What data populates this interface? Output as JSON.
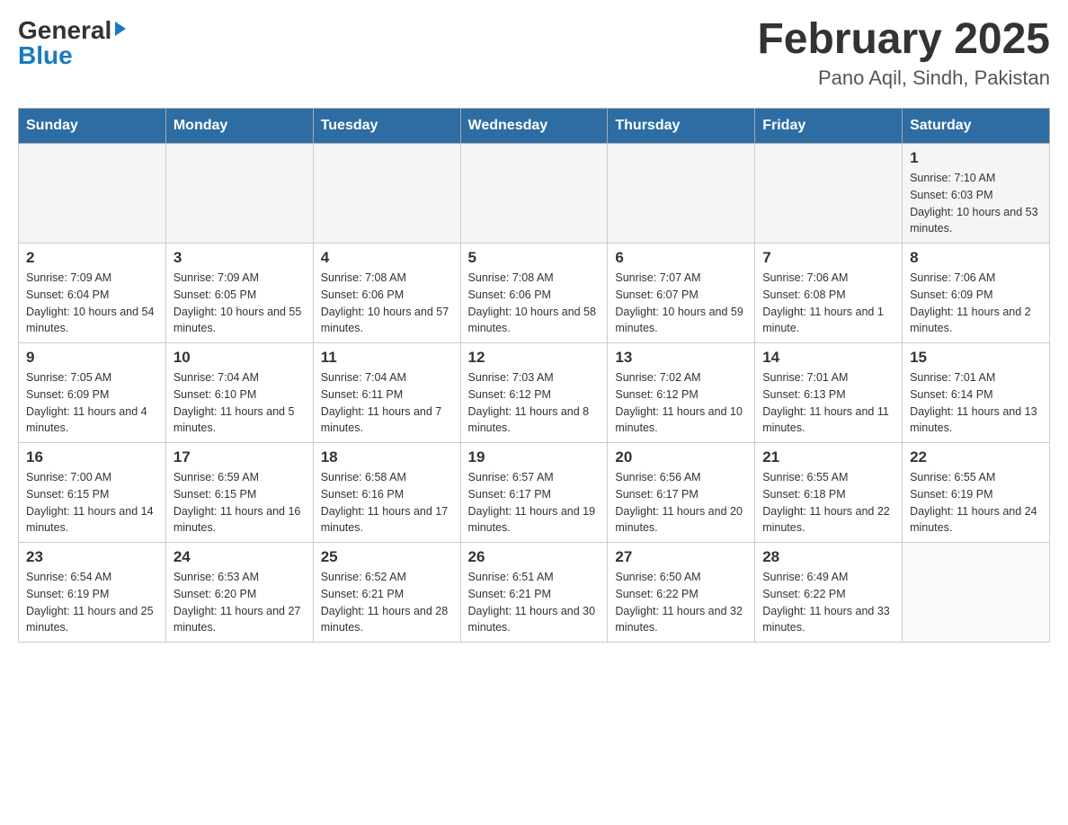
{
  "header": {
    "logo_general": "General",
    "logo_blue": "Blue",
    "month_title": "February 2025",
    "location": "Pano Aqil, Sindh, Pakistan"
  },
  "days_of_week": [
    "Sunday",
    "Monday",
    "Tuesday",
    "Wednesday",
    "Thursday",
    "Friday",
    "Saturday"
  ],
  "weeks": [
    [
      {
        "day": "",
        "info": ""
      },
      {
        "day": "",
        "info": ""
      },
      {
        "day": "",
        "info": ""
      },
      {
        "day": "",
        "info": ""
      },
      {
        "day": "",
        "info": ""
      },
      {
        "day": "",
        "info": ""
      },
      {
        "day": "1",
        "info": "Sunrise: 7:10 AM\nSunset: 6:03 PM\nDaylight: 10 hours and 53 minutes."
      }
    ],
    [
      {
        "day": "2",
        "info": "Sunrise: 7:09 AM\nSunset: 6:04 PM\nDaylight: 10 hours and 54 minutes."
      },
      {
        "day": "3",
        "info": "Sunrise: 7:09 AM\nSunset: 6:05 PM\nDaylight: 10 hours and 55 minutes."
      },
      {
        "day": "4",
        "info": "Sunrise: 7:08 AM\nSunset: 6:06 PM\nDaylight: 10 hours and 57 minutes."
      },
      {
        "day": "5",
        "info": "Sunrise: 7:08 AM\nSunset: 6:06 PM\nDaylight: 10 hours and 58 minutes."
      },
      {
        "day": "6",
        "info": "Sunrise: 7:07 AM\nSunset: 6:07 PM\nDaylight: 10 hours and 59 minutes."
      },
      {
        "day": "7",
        "info": "Sunrise: 7:06 AM\nSunset: 6:08 PM\nDaylight: 11 hours and 1 minute."
      },
      {
        "day": "8",
        "info": "Sunrise: 7:06 AM\nSunset: 6:09 PM\nDaylight: 11 hours and 2 minutes."
      }
    ],
    [
      {
        "day": "9",
        "info": "Sunrise: 7:05 AM\nSunset: 6:09 PM\nDaylight: 11 hours and 4 minutes."
      },
      {
        "day": "10",
        "info": "Sunrise: 7:04 AM\nSunset: 6:10 PM\nDaylight: 11 hours and 5 minutes."
      },
      {
        "day": "11",
        "info": "Sunrise: 7:04 AM\nSunset: 6:11 PM\nDaylight: 11 hours and 7 minutes."
      },
      {
        "day": "12",
        "info": "Sunrise: 7:03 AM\nSunset: 6:12 PM\nDaylight: 11 hours and 8 minutes."
      },
      {
        "day": "13",
        "info": "Sunrise: 7:02 AM\nSunset: 6:12 PM\nDaylight: 11 hours and 10 minutes."
      },
      {
        "day": "14",
        "info": "Sunrise: 7:01 AM\nSunset: 6:13 PM\nDaylight: 11 hours and 11 minutes."
      },
      {
        "day": "15",
        "info": "Sunrise: 7:01 AM\nSunset: 6:14 PM\nDaylight: 11 hours and 13 minutes."
      }
    ],
    [
      {
        "day": "16",
        "info": "Sunrise: 7:00 AM\nSunset: 6:15 PM\nDaylight: 11 hours and 14 minutes."
      },
      {
        "day": "17",
        "info": "Sunrise: 6:59 AM\nSunset: 6:15 PM\nDaylight: 11 hours and 16 minutes."
      },
      {
        "day": "18",
        "info": "Sunrise: 6:58 AM\nSunset: 6:16 PM\nDaylight: 11 hours and 17 minutes."
      },
      {
        "day": "19",
        "info": "Sunrise: 6:57 AM\nSunset: 6:17 PM\nDaylight: 11 hours and 19 minutes."
      },
      {
        "day": "20",
        "info": "Sunrise: 6:56 AM\nSunset: 6:17 PM\nDaylight: 11 hours and 20 minutes."
      },
      {
        "day": "21",
        "info": "Sunrise: 6:55 AM\nSunset: 6:18 PM\nDaylight: 11 hours and 22 minutes."
      },
      {
        "day": "22",
        "info": "Sunrise: 6:55 AM\nSunset: 6:19 PM\nDaylight: 11 hours and 24 minutes."
      }
    ],
    [
      {
        "day": "23",
        "info": "Sunrise: 6:54 AM\nSunset: 6:19 PM\nDaylight: 11 hours and 25 minutes."
      },
      {
        "day": "24",
        "info": "Sunrise: 6:53 AM\nSunset: 6:20 PM\nDaylight: 11 hours and 27 minutes."
      },
      {
        "day": "25",
        "info": "Sunrise: 6:52 AM\nSunset: 6:21 PM\nDaylight: 11 hours and 28 minutes."
      },
      {
        "day": "26",
        "info": "Sunrise: 6:51 AM\nSunset: 6:21 PM\nDaylight: 11 hours and 30 minutes."
      },
      {
        "day": "27",
        "info": "Sunrise: 6:50 AM\nSunset: 6:22 PM\nDaylight: 11 hours and 32 minutes."
      },
      {
        "day": "28",
        "info": "Sunrise: 6:49 AM\nSunset: 6:22 PM\nDaylight: 11 hours and 33 minutes."
      },
      {
        "day": "",
        "info": ""
      }
    ]
  ]
}
